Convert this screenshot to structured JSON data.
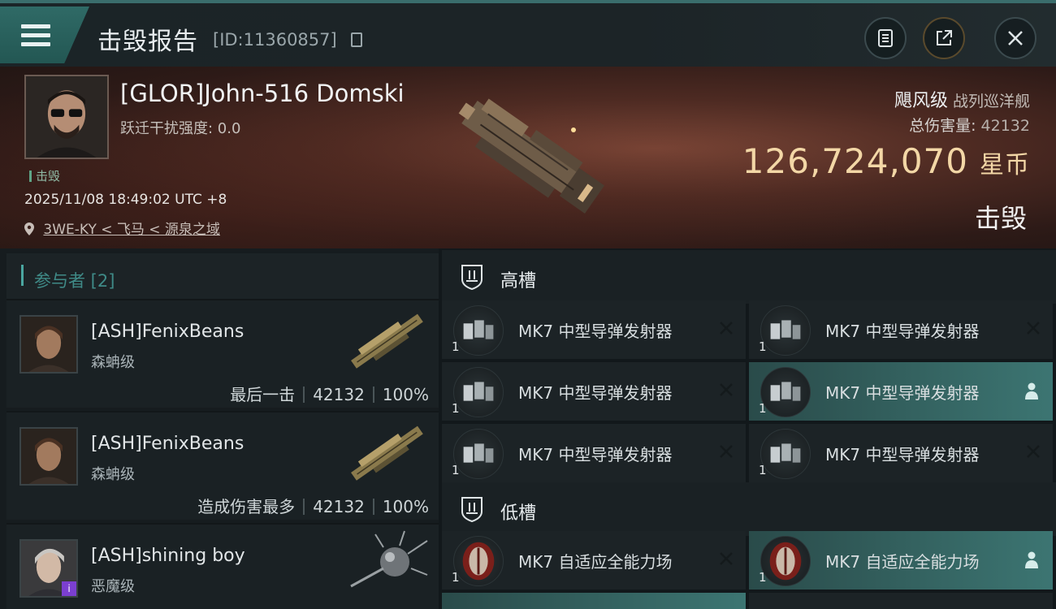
{
  "header": {
    "title": "击毁报告",
    "report_id": "[ID:11360857]"
  },
  "victim": {
    "name": "[GLOR]John-516 Domski",
    "warp_disruption": "跃迁干扰强度: 0.0",
    "status_tag": "击毁",
    "datetime": "2025/11/08 18:49:02 UTC +8",
    "location": "3WE-KY < 飞马 < 源泉之域",
    "ship_name": "飓风级",
    "ship_type": "战列巡洋舰",
    "total_damage_label": "总伤害量:",
    "total_damage_value": "42132",
    "isk_value": "126,724,070",
    "isk_unit": "星币",
    "result": "击毁"
  },
  "participants": {
    "header": "参与者 [2]",
    "items": [
      {
        "name": "[ASH]FenixBeans",
        "ship": "森蚺级",
        "role": "最后一击",
        "damage": "42132",
        "percent": "100%"
      },
      {
        "name": "[ASH]FenixBeans",
        "ship": "森蚺级",
        "role": "造成伤害最多",
        "damage": "42132",
        "percent": "100%"
      },
      {
        "name": "[ASH]shining boy",
        "ship": "恶魔级",
        "badge": "i"
      }
    ]
  },
  "fitting": {
    "high_slot_label": "高槽",
    "low_slot_label": "低槽",
    "high_slots": [
      {
        "name": "MK7 中型导弹发射器",
        "qty": "1",
        "state": "destroyed"
      },
      {
        "name": "MK7 中型导弹发射器",
        "qty": "1",
        "state": "destroyed"
      },
      {
        "name": "MK7 中型导弹发射器",
        "qty": "1",
        "state": "destroyed"
      },
      {
        "name": "MK7 中型导弹发射器",
        "qty": "1",
        "state": "dropped"
      },
      {
        "name": "MK7 中型导弹发射器",
        "qty": "1",
        "state": "destroyed"
      },
      {
        "name": "MK7 中型导弹发射器",
        "qty": "1",
        "state": "destroyed"
      }
    ],
    "low_slots": [
      {
        "name": "MK7 自适应全能力场",
        "qty": "1",
        "state": "destroyed"
      },
      {
        "name": "MK7 自适应全能力场",
        "qty": "1",
        "state": "dropped"
      }
    ]
  },
  "colors": {
    "accent": "#3c7572",
    "isk": "#f3d7a6",
    "badge": "#7b3fd0"
  }
}
